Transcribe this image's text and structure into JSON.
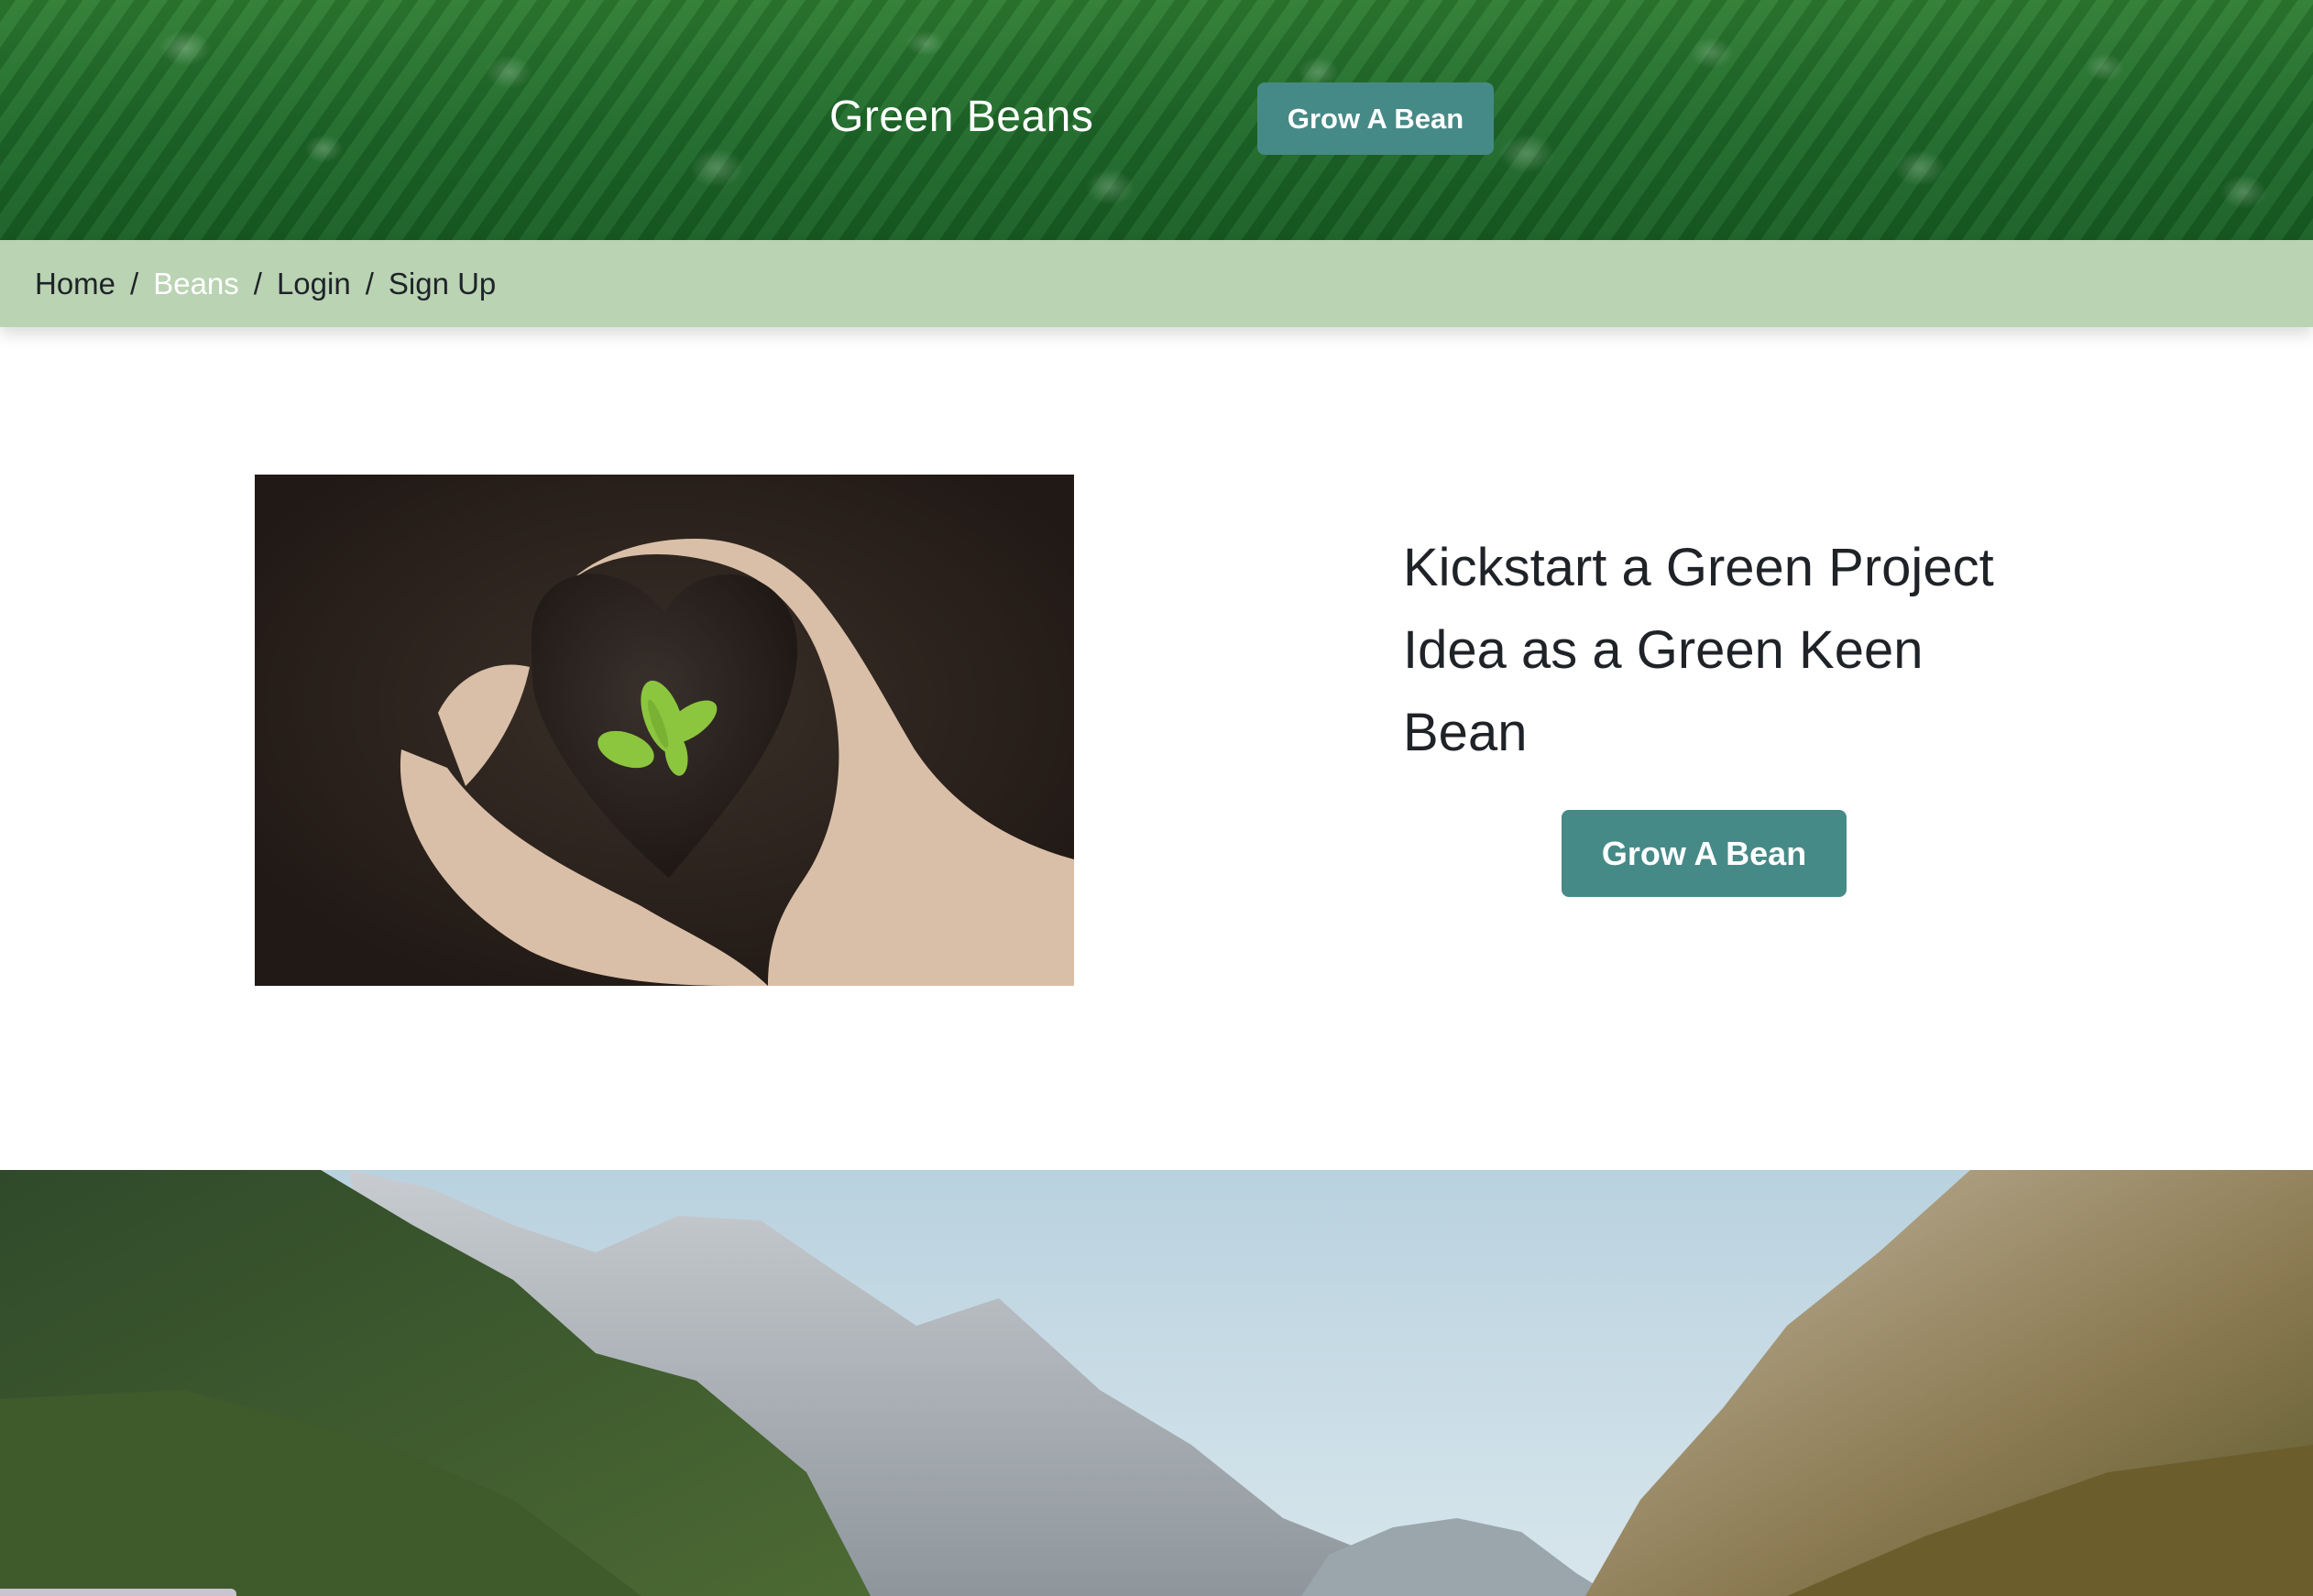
{
  "header": {
    "site_title": "Green Beans",
    "cta_label": "Grow A Bean"
  },
  "breadcrumb": {
    "items": [
      {
        "label": "Home",
        "active": false
      },
      {
        "label": "Beans",
        "active": true
      },
      {
        "label": "Login",
        "active": false
      },
      {
        "label": "Sign Up",
        "active": false
      }
    ],
    "separator": "/"
  },
  "hero": {
    "heading": "Kickstart a Green Project Idea as a Green Keen Bean",
    "cta_label": "Grow A Bean",
    "image": "hands-holding-soil-heart-with-sprout"
  },
  "banner": {
    "image": "mountain-valley-landscape"
  },
  "colors": {
    "accent_button": "#468a87",
    "breadcrumb_bg": "#b9d3b3",
    "active_crumb": "#ffffff",
    "header_green": "#1f6b2a"
  }
}
